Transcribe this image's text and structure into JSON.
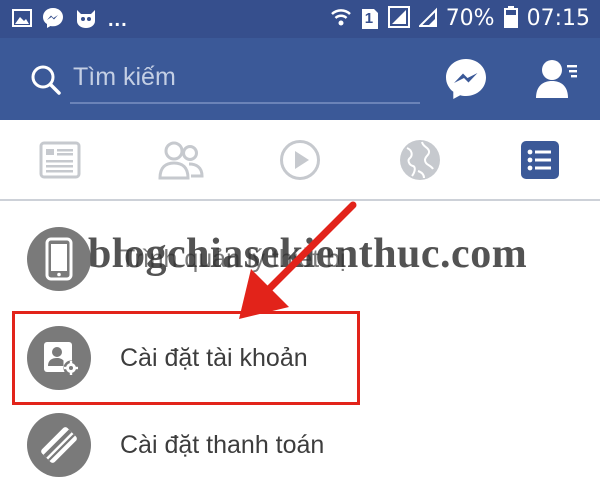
{
  "status_bar": {
    "battery": "70%",
    "time": "07:15",
    "notification_dots": "...",
    "sim_slot": "1",
    "colors": {
      "background": "#364f8d"
    }
  },
  "top_bar": {
    "search_placeholder": "Tìm kiếm",
    "colors": {
      "background": "#3b5998"
    }
  },
  "nav_tabs": [
    {
      "icon": "news-feed-icon",
      "active": false
    },
    {
      "icon": "friends-icon",
      "active": false
    },
    {
      "icon": "video-play-icon",
      "active": false
    },
    {
      "icon": "globe-icon",
      "active": false
    },
    {
      "icon": "menu-list-icon",
      "active": true
    }
  ],
  "menu": {
    "items": [
      {
        "label": "Trình quản lý thiết bị",
        "icon": "phone-icon"
      },
      {
        "label": "Cài đặt tài khoản",
        "icon": "account-settings-icon"
      },
      {
        "label": "Cài đặt thanh toán",
        "icon": "payment-icon"
      }
    ]
  },
  "watermark": "blogchiasekienthuc.com",
  "annotation": {
    "color": "#e2231a"
  }
}
